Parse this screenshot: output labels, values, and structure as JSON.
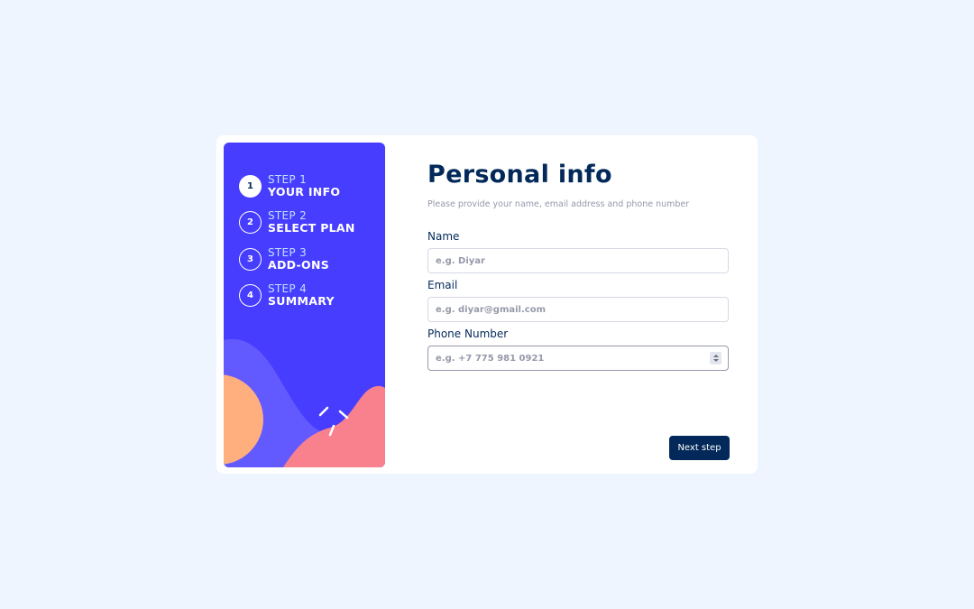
{
  "sidebar": {
    "steps": [
      {
        "number": "1",
        "label": "STEP 1",
        "title": "YOUR INFO",
        "active": true
      },
      {
        "number": "2",
        "label": "STEP 2",
        "title": "SELECT PLAN",
        "active": false
      },
      {
        "number": "3",
        "label": "STEP 3",
        "title": "ADD-ONS",
        "active": false
      },
      {
        "number": "4",
        "label": "STEP 4",
        "title": "SUMMARY",
        "active": false
      }
    ]
  },
  "form": {
    "title": "Personal info",
    "description": "Please provide your name, email address and phone number",
    "name": {
      "label": "Name",
      "placeholder": "e.g. Diyar",
      "value": ""
    },
    "email": {
      "label": "Email",
      "placeholder": "e.g. diyar@gmail.com",
      "value": ""
    },
    "phone": {
      "label": "Phone Number",
      "placeholder": "e.g. +7 775 981 0921",
      "value": ""
    },
    "next_label": "Next step"
  },
  "colors": {
    "page_bg": "#eff5ff",
    "sidebar_bg": "#473dff",
    "marine_blue": "#022959",
    "light_blue": "#bfe2fd",
    "grey": "#9699aa",
    "border": "#d6d9e6",
    "orange": "#ffaf7e",
    "pink": "#f9818e",
    "purple": "#6259ff"
  }
}
